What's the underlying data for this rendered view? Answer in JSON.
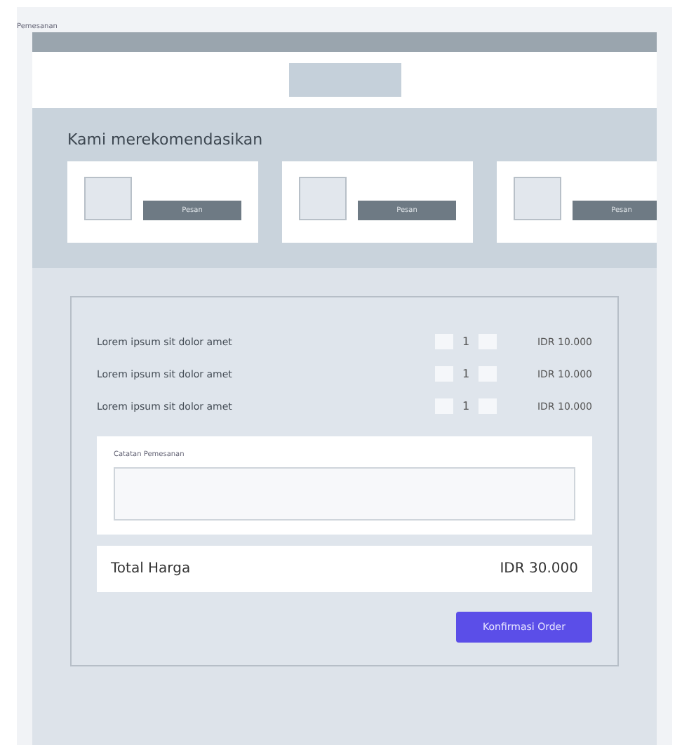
{
  "page_label": "Pemesanan",
  "recommendations": {
    "title": "Kami merekomendasikan",
    "items": [
      {
        "button": "Pesan"
      },
      {
        "button": "Pesan"
      },
      {
        "button": "Pesan"
      }
    ]
  },
  "order": {
    "items": [
      {
        "name": "Lorem ipsum sit dolor amet",
        "quantity": "1",
        "price": "IDR 10.000"
      },
      {
        "name": "Lorem ipsum sit dolor amet",
        "quantity": "1",
        "price": "IDR 10.000"
      },
      {
        "name": "Lorem ipsum sit dolor amet",
        "quantity": "1",
        "price": "IDR 10.000"
      }
    ],
    "notes_label": "Catatan Pemesanan",
    "total_label": "Total Harga",
    "total_value": "IDR 30.000",
    "confirm_button": "Konfirmasi Order"
  }
}
